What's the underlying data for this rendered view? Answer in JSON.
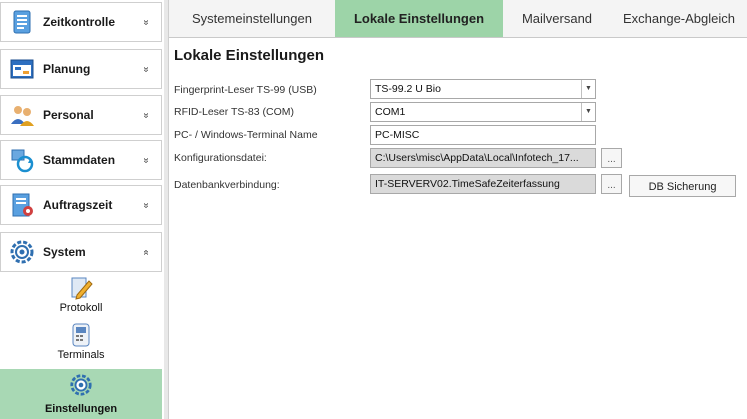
{
  "sidebar": {
    "groups": [
      {
        "label": "Zeitkontrolle",
        "icon": "document-icon",
        "chevron": "»"
      },
      {
        "label": "Planung",
        "icon": "calendar-icon",
        "chevron": "»"
      },
      {
        "label": "Personal",
        "icon": "people-icon",
        "chevron": "»"
      },
      {
        "label": "Stammdaten",
        "icon": "refresh-icon",
        "chevron": "»"
      },
      {
        "label": "Auftragszeit",
        "icon": "report-icon",
        "chevron": "»"
      },
      {
        "label": "System",
        "icon": "gear-icon",
        "chevron": "«"
      }
    ],
    "system_items": [
      {
        "label": "Protokoll",
        "icon": "pencil-icon"
      },
      {
        "label": "Terminals",
        "icon": "terminal-icon"
      },
      {
        "label": "Einstellungen",
        "icon": "gear-icon",
        "active": true
      }
    ]
  },
  "tabs": [
    {
      "label": "Systemeinstellungen"
    },
    {
      "label": "Lokale Einstellungen",
      "active": true
    },
    {
      "label": "Mailversand"
    },
    {
      "label": "Exchange-Abgleich"
    }
  ],
  "main": {
    "title": "Lokale Einstellungen",
    "fields": [
      {
        "label": "Fingerprint-Leser TS-99 (USB)",
        "value": "TS-99.2 U Bio"
      },
      {
        "label": "RFID-Leser TS-83 (COM)",
        "value": "COM1"
      },
      {
        "label": "PC- / Windows-Terminal Name",
        "value": "PC-MISC"
      },
      {
        "label": "Konfigurationsdatei:",
        "value": "C:\\Users\\misc\\AppData\\Local\\Infotech_17..."
      },
      {
        "label": "Datenbankverbindung:",
        "value": "IT-SERVERV02.TimeSafeZeiterfassung"
      }
    ],
    "ellipsis_label": "...",
    "db_backup_button": "DB Sicherung"
  },
  "colors": {
    "active_tab": "#9dd4a8",
    "active_sidebar_item": "#a8d8b4",
    "readonly_field": "#dadada"
  }
}
